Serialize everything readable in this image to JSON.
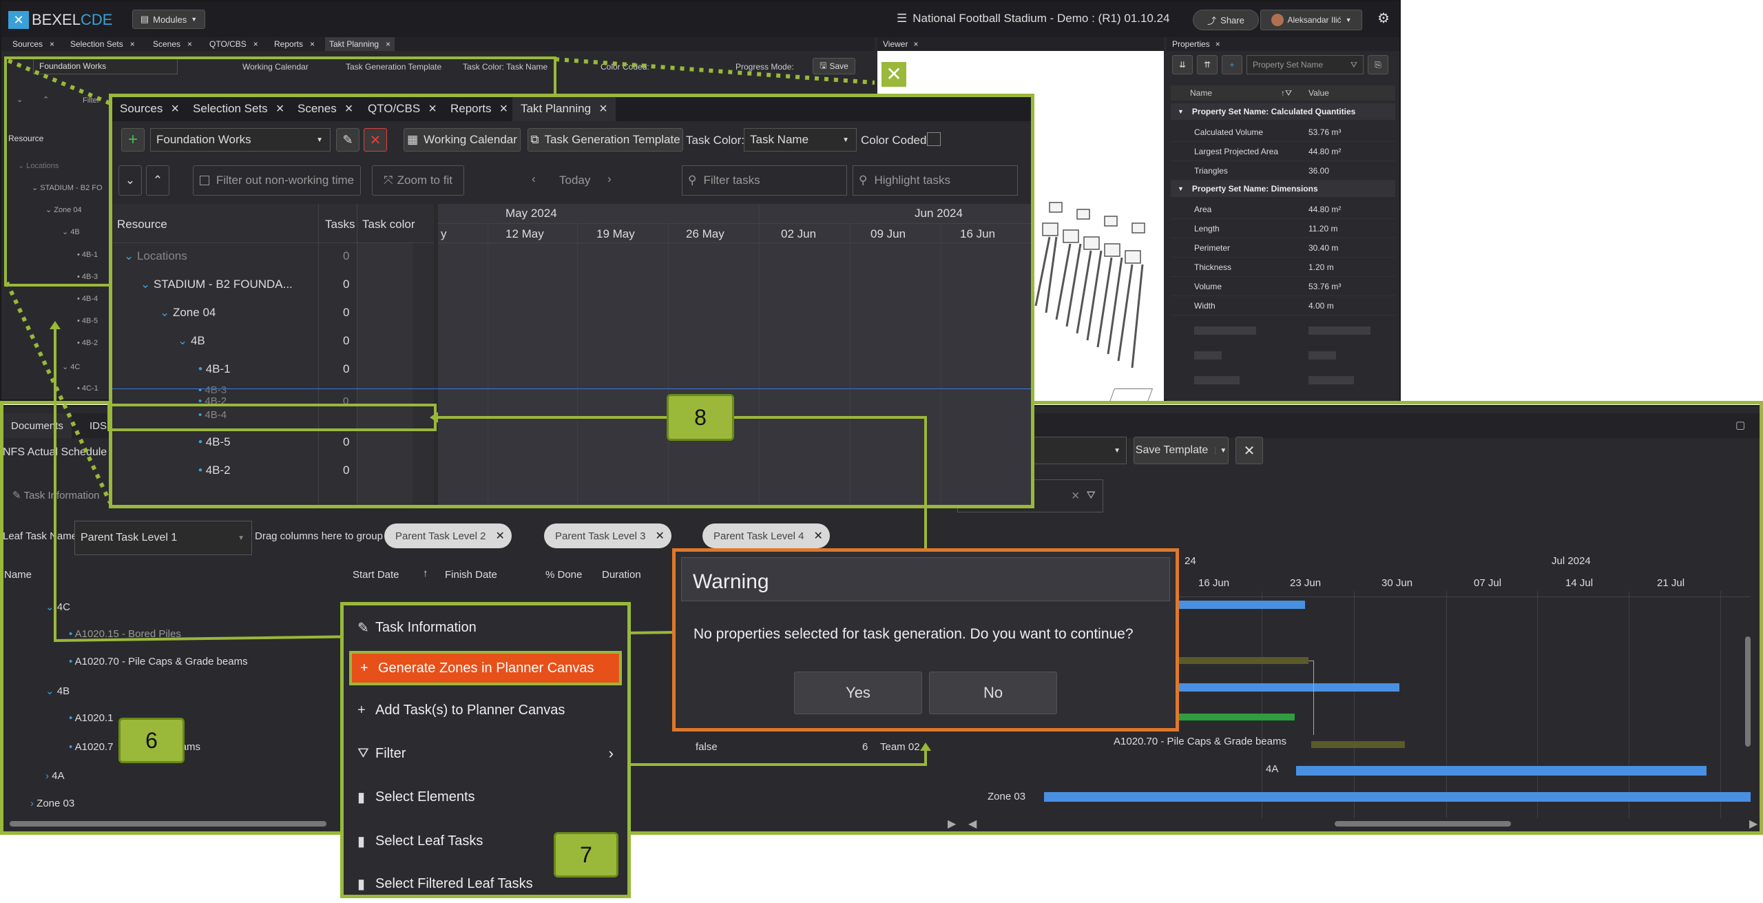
{
  "app": {
    "logo_left": "BEXEL",
    "logo_right": "CDE",
    "modules_label": "Modules",
    "title": "National Football Stadium - Demo : (R1) 01.10.24",
    "share_label": "Share",
    "user_name": "Aleksandar Ilić"
  },
  "bg_tabs": [
    "Sources",
    "Selection Sets",
    "Scenes",
    "QTO/CBS",
    "Reports",
    "Takt Planning"
  ],
  "viewer_tab": "Viewer",
  "properties": {
    "tab": "Properties",
    "filter_placeholder": "Property Set Name",
    "col_name": "Name",
    "col_value": "Value",
    "groups": [
      {
        "title": "Property Set Name: Calculated Quantities",
        "rows": [
          {
            "name": "Calculated Volume",
            "value": "53.76 m³"
          },
          {
            "name": "Largest Projected Area",
            "value": "44.80 m²"
          },
          {
            "name": "Triangles",
            "value": "36.00"
          }
        ]
      },
      {
        "title": "Property Set Name: Dimensions",
        "rows": [
          {
            "name": "Area",
            "value": "44.80 m²"
          },
          {
            "name": "Length",
            "value": "11.20 m"
          },
          {
            "name": "Perimeter",
            "value": "30.40 m"
          },
          {
            "name": "Thickness",
            "value": "1.20 m"
          },
          {
            "name": "Volume",
            "value": "53.76 m³"
          },
          {
            "name": "Width",
            "value": "4.00 m"
          }
        ]
      }
    ]
  },
  "bg_takt": {
    "template": "Foundation Works",
    "working_calendar": "Working Calendar",
    "task_gen_template": "Task Generation Template",
    "task_color_label": "Task Color:",
    "task_color_value": "Task Name",
    "color_coded": "Color Coded:",
    "progress_mode": "Progress Mode:",
    "save": "Save",
    "filter_label": "Filter",
    "resource": "Resource",
    "tree": [
      "Locations",
      "STADIUM - B2 FO",
      "Zone 04",
      "4B",
      "4B-1",
      "4B-3",
      "4B-4",
      "4B-5",
      "4B-2",
      "4C",
      "4C-1"
    ]
  },
  "zoom": {
    "tabs": [
      "Sources",
      "Selection Sets",
      "Scenes",
      "QTO/CBS",
      "Reports",
      "Takt Planning"
    ],
    "template": "Foundation Works",
    "working_calendar": "Working Calendar",
    "task_gen_template": "Task Generation Template",
    "task_color_label": "Task Color:",
    "task_color_value": "Task Name",
    "color_coded": "Color Coded:",
    "filter_nonworking": "Filter out non-working time",
    "zoom_to_fit": "Zoom to fit",
    "today": "Today",
    "filter_tasks": "Filter tasks",
    "highlight_tasks": "Highlight tasks",
    "col_resource": "Resource",
    "col_tasks": "Tasks",
    "col_task_color": "Task color",
    "month1": "May 2024",
    "month2": "Jun 2024",
    "weeks": [
      "y",
      "12 May",
      "19 May",
      "26 May",
      "02 Jun",
      "09 Jun",
      "16 Jun"
    ],
    "rows": [
      {
        "label": "Locations",
        "count": "0"
      },
      {
        "label": "STADIUM - B2 FOUNDA...",
        "count": "0"
      },
      {
        "label": "Zone 04",
        "count": "0"
      },
      {
        "label": "4B",
        "count": "0"
      },
      {
        "label": "4B-1",
        "count": "0"
      },
      {
        "label": "4B-2",
        "count": "0"
      },
      {
        "label": "4B-4",
        "count": "0"
      },
      {
        "label": "4B-5",
        "count": "0"
      },
      {
        "label": "4B-2",
        "count": "0"
      }
    ],
    "ghost_row": "4B-3"
  },
  "bottom": {
    "tab1": "Documents",
    "tab2": "IDS",
    "schedule": "NFS Actual Schedule P",
    "save_template": "Save Template",
    "task_information": "Task Information",
    "leaf_label": "Leaf Task Name:",
    "leaf_value": "Parent Task Level 1",
    "drag_label": "Drag columns here to group",
    "chips": [
      "Parent Task Level 2",
      "Parent Task Level 3",
      "Parent Task Level 4"
    ],
    "cols": [
      "Name",
      "Start Date",
      "Finish Date",
      "% Done",
      "Duration"
    ],
    "tree": [
      {
        "label": "4C",
        "kind": "group"
      },
      {
        "label": "A1020.15 - Bored Piles",
        "kind": "leaf"
      },
      {
        "label": "A1020.70 - Pile Caps & Grade beams",
        "kind": "leaf"
      },
      {
        "label": "4B",
        "kind": "group"
      },
      {
        "label": "A1020.1",
        "kind": "leaf"
      },
      {
        "label": "A1020.7",
        "kind": "leaf"
      },
      {
        "label": "4A",
        "kind": "collapsed"
      },
      {
        "label": "Zone 03",
        "kind": "collapsed"
      }
    ],
    "row_false": "false",
    "row_duration": "6",
    "row_team": "Team 02",
    "gantt_header_partial": "24",
    "gantt_month": "Jul 2024",
    "gantt_weeks": [
      "16 Jun",
      "23 Jun",
      "30 Jun",
      "07 Jul",
      "14 Jul",
      "21 Jul"
    ],
    "gantt_label": "A1020.70 - Pile Caps & Grade beams",
    "gantt_4a": "4A",
    "gantt_zone03": "Zone 03"
  },
  "context_menu": {
    "items": [
      {
        "label": "Task Information",
        "icon": "pencil-icon"
      },
      {
        "label": "Generate Zones in Planner Canvas",
        "icon": "plus-icon"
      },
      {
        "label": "Add Task(s) to Planner Canvas",
        "icon": "plus-icon"
      },
      {
        "label": "Filter",
        "icon": "filter-icon"
      },
      {
        "label": "Select Elements",
        "icon": "bookmark-icon"
      },
      {
        "label": "Select Leaf Tasks",
        "icon": "bookmark-icon"
      },
      {
        "label": "Select Filtered Leaf Tasks",
        "icon": "bookmark-icon"
      }
    ]
  },
  "dialog": {
    "title": "Warning",
    "message": "No properties selected for task generation. Do you want to continue?",
    "yes": "Yes",
    "no": "No"
  },
  "badges": {
    "b6": "6",
    "b7": "7",
    "b8": "8"
  },
  "colors": {
    "accent_green": "#9ab83a",
    "warning_orange": "#e0782a",
    "menu_highlight": "#e8501a",
    "gantt_blue": "#4a90e2",
    "gantt_olive": "#5a5a2a",
    "gantt_green": "#2e9e3e"
  }
}
